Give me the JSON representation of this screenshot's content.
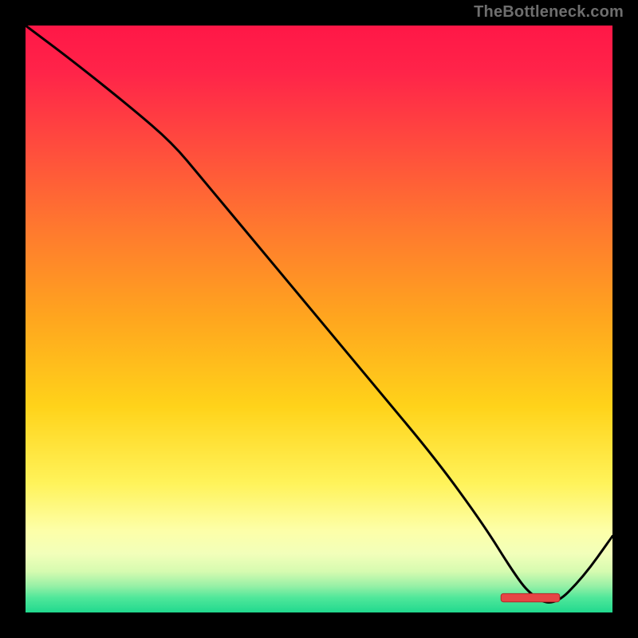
{
  "attribution": "TheBottleneck.com",
  "colors": {
    "frame": "#000000",
    "attribution_text": "#6e6e6e",
    "curve": "#000000",
    "marker_fill": "#e64545",
    "marker_stroke": "#b02a2a"
  },
  "chart_data": {
    "type": "line",
    "title": "",
    "xlabel": "",
    "ylabel": "",
    "xlim": [
      0,
      100
    ],
    "ylim": [
      0,
      100
    ],
    "gradient_stops": [
      {
        "offset": 0.0,
        "color": "#ff1747"
      },
      {
        "offset": 0.08,
        "color": "#ff2449"
      },
      {
        "offset": 0.2,
        "color": "#ff4a3e"
      },
      {
        "offset": 0.35,
        "color": "#ff7a2e"
      },
      {
        "offset": 0.5,
        "color": "#ffa61e"
      },
      {
        "offset": 0.65,
        "color": "#ffd31a"
      },
      {
        "offset": 0.78,
        "color": "#fff35a"
      },
      {
        "offset": 0.86,
        "color": "#fdffa8"
      },
      {
        "offset": 0.9,
        "color": "#f2ffba"
      },
      {
        "offset": 0.93,
        "color": "#d6fbb0"
      },
      {
        "offset": 0.955,
        "color": "#97f0a6"
      },
      {
        "offset": 0.975,
        "color": "#4fe79a"
      },
      {
        "offset": 1.0,
        "color": "#21d98e"
      }
    ],
    "series": [
      {
        "name": "bottleneck-curve",
        "x": [
          0,
          8,
          18,
          25,
          30,
          40,
          50,
          60,
          70,
          78,
          83,
          86,
          90,
          95,
          100
        ],
        "values": [
          100,
          94,
          86,
          80,
          74,
          62,
          50,
          38,
          26,
          15,
          7,
          3,
          1,
          6,
          13
        ]
      }
    ],
    "marker": {
      "label": "",
      "x_start": 81,
      "x_end": 91,
      "y": 2.5,
      "height": 1.4
    }
  }
}
